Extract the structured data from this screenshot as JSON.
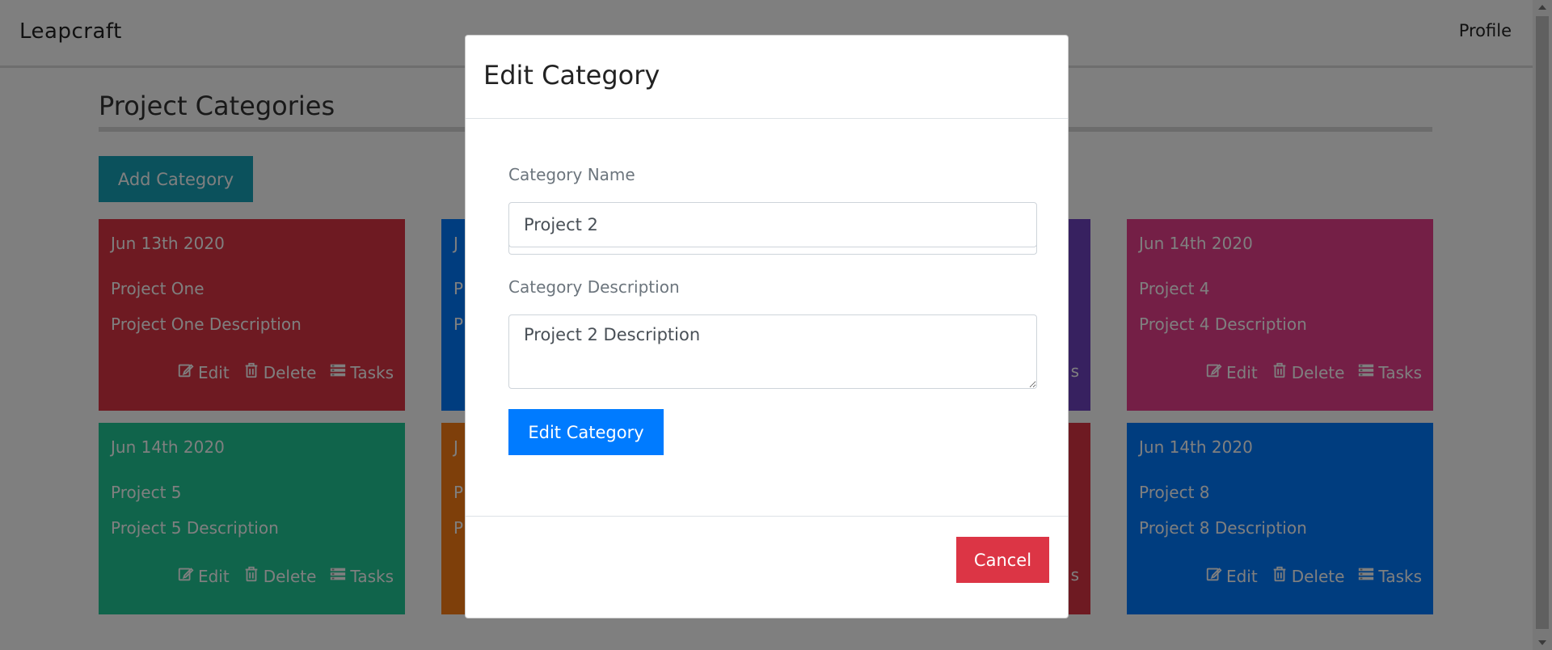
{
  "navbar": {
    "brand": "Leapcraft",
    "profile": "Profile"
  },
  "page": {
    "title": "Project Categories",
    "add_button": "Add Category"
  },
  "card_actions": {
    "edit": "Edit",
    "delete": "Delete",
    "tasks": "Tasks"
  },
  "cards": [
    {
      "date": "Jun 13th 2020",
      "name": "Project One",
      "description": "Project One Description",
      "color": "#dc3545"
    },
    {
      "date": "Jun 14th 2020",
      "name": "Project 4",
      "description": "Project 4 Description",
      "color": "#e83e8c"
    },
    {
      "date": "Jun 14th 2020",
      "name": "Project 5",
      "description": "Project 5 Description",
      "color": "#20c997"
    },
    {
      "date": "Jun 14th 2020",
      "name": "Project 8",
      "description": "Project 8 Description",
      "color": "#007bff"
    },
    {
      "date": "J",
      "name": "P",
      "description": "P",
      "color": "#007bff"
    },
    {
      "date": "J",
      "name": "P",
      "description": "P",
      "color": "#fd7e14"
    },
    {
      "color": "#6f42c1",
      "partial_action": "s"
    },
    {
      "color": "#dc3545",
      "partial_action": "s"
    }
  ],
  "modal": {
    "title": "Edit Category",
    "name_label": "Category Name",
    "name_value": "Project 2",
    "description_label": "Category Description",
    "description_value": "Project 2 Description",
    "submit_button": "Edit Category",
    "cancel_button": "Cancel"
  }
}
